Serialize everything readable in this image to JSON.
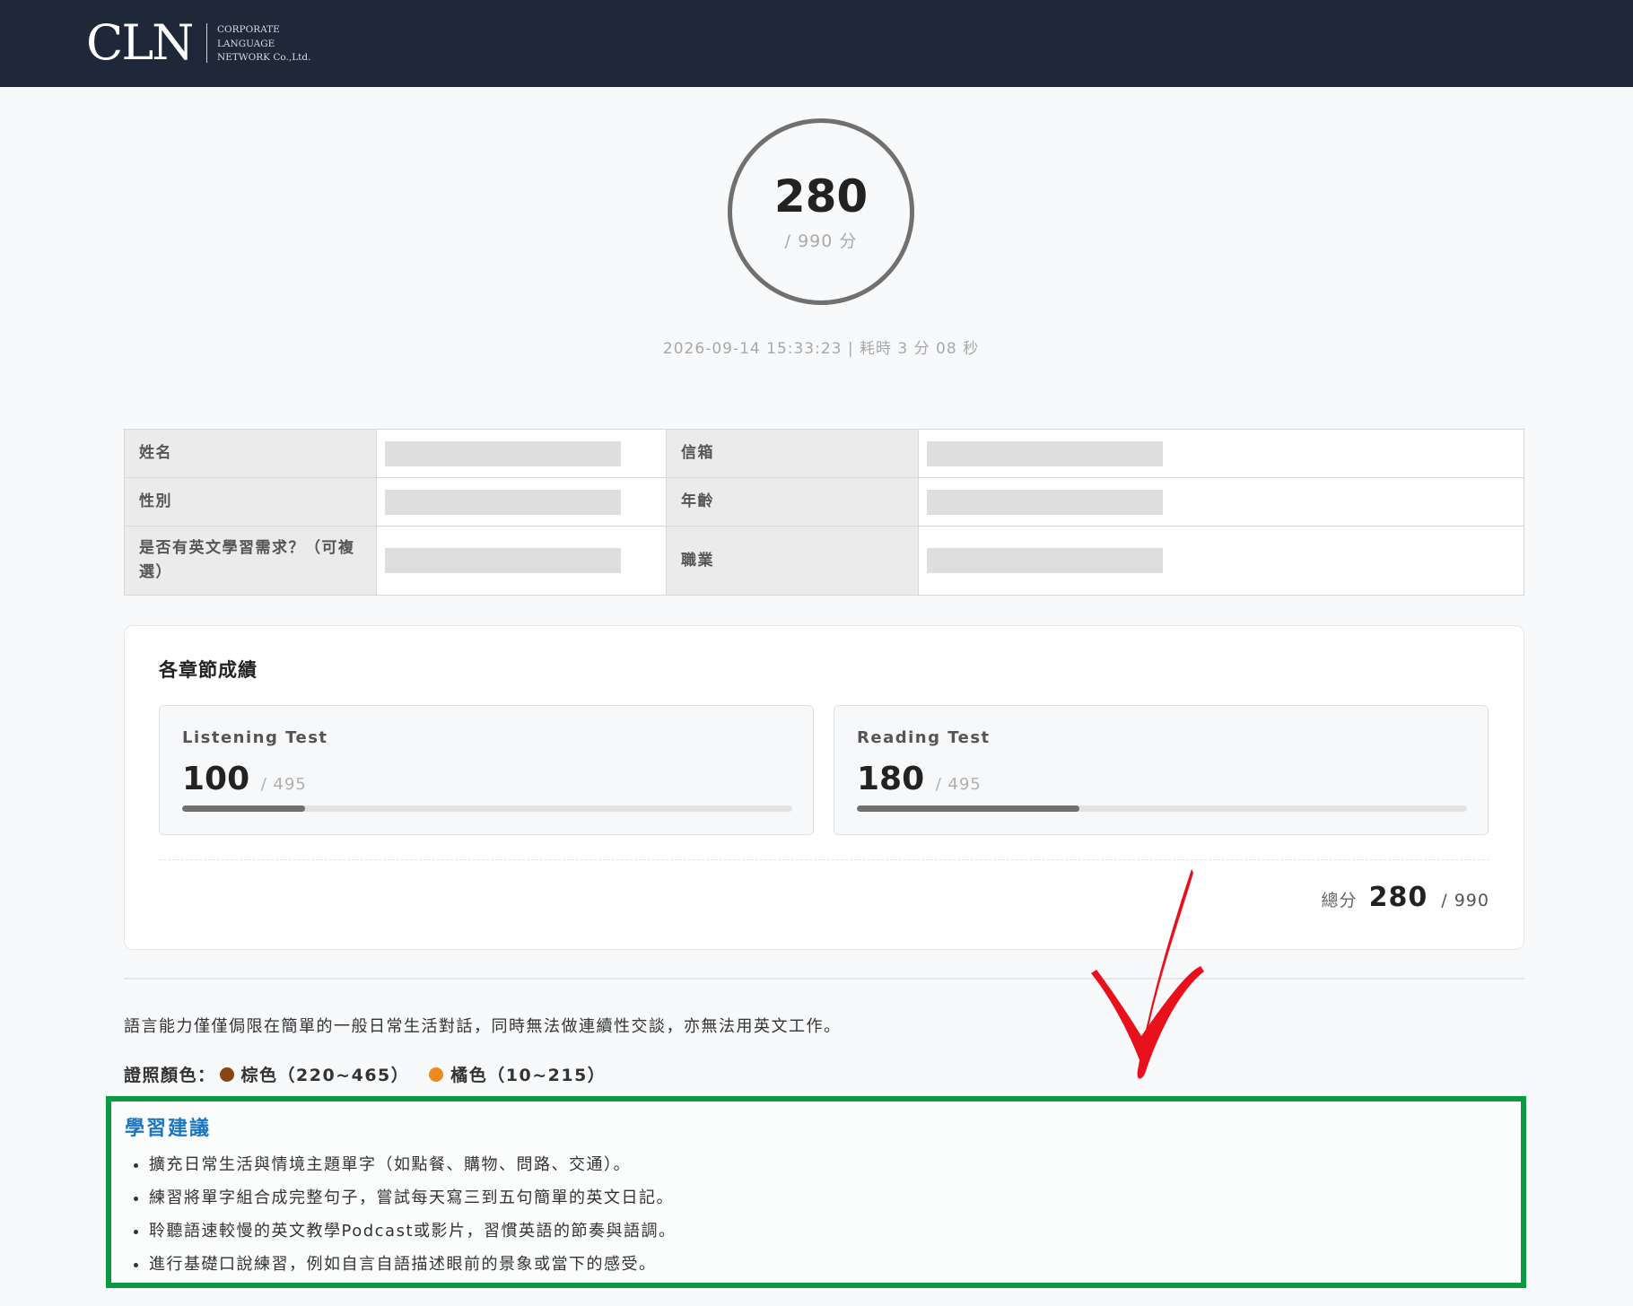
{
  "header": {
    "logo_mark": "CLN",
    "logo_lines": [
      "CORPORATE",
      "LANGUAGE",
      "NETWORK Co.,Ltd."
    ]
  },
  "score": {
    "value": "280",
    "max_label": "/ 990 分",
    "meta": "2026-09-14 15:33:23 | 耗時 3 分 08 秒"
  },
  "profile": {
    "name_label": "姓名",
    "email_label": "信箱",
    "gender_label": "性別",
    "age_label": "年齡",
    "need_label": "是否有英文學習需求？（可複選）",
    "job_label": "職業"
  },
  "sections": {
    "title": "各章節成績",
    "listening": {
      "name": "Listening Test",
      "score": "100",
      "max": "/ 495",
      "progress": 0.202
    },
    "reading": {
      "name": "Reading Test",
      "score": "180",
      "max": "/ 495",
      "progress": 0.364
    },
    "total_label": "總分",
    "total_score": "280",
    "total_max": "/ 990"
  },
  "description": "語言能力僅僅侷限在簡單的一般日常生活對話，同時無法做連續性交談，亦無法用英文工作。",
  "certificate": {
    "label": "證照顏色：",
    "items": [
      {
        "text": "棕色（220~465）",
        "color": "#8b4513"
      },
      {
        "text": "橘色（10~215）",
        "color": "#ef8a1e"
      }
    ]
  },
  "advice": {
    "title": "學習建議",
    "items": [
      "擴充日常生活與情境主題單字（如點餐、購物、問路、交通）。",
      "練習將單字組合成完整句子，嘗試每天寫三到五句簡單的英文日記。",
      "聆聽語速較慢的英文教學Podcast或影片，習慣英語的節奏與語調。",
      "進行基礎口說練習，例如自言自語描述眼前的景象或當下的感受。"
    ]
  },
  "colors": {
    "header_bg": "#1f2838",
    "advice_border": "#0a9a3f",
    "advice_title": "#1b76c2",
    "annotation_check": "#e8101a"
  }
}
